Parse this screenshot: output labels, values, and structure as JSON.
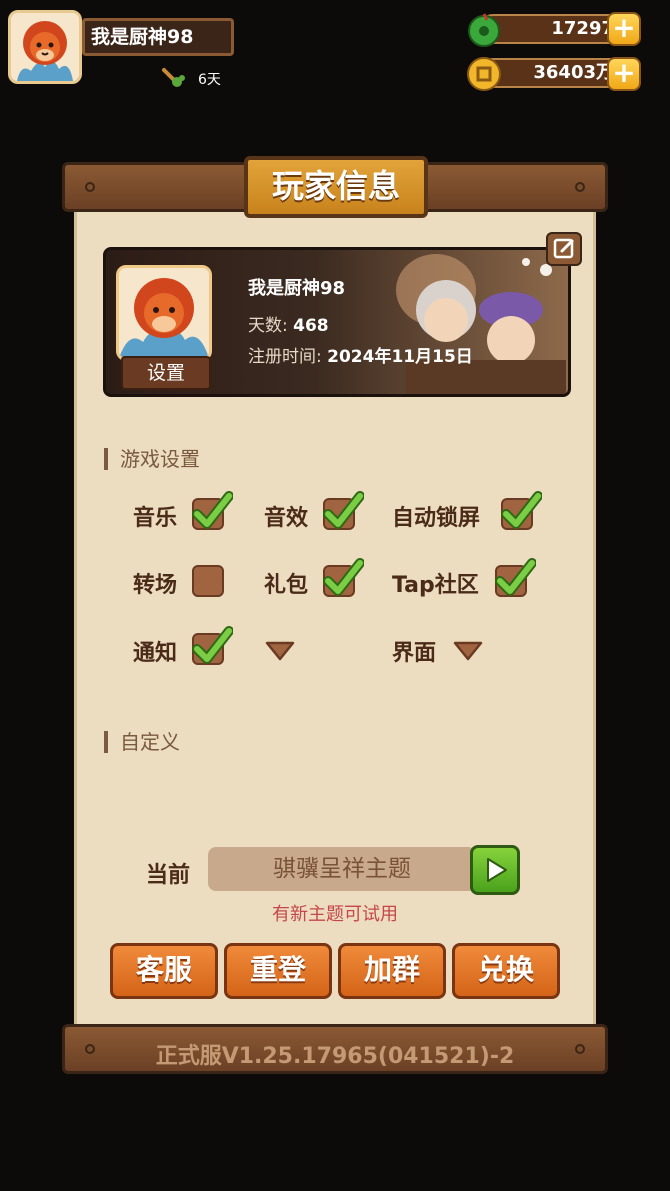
{
  "header": {
    "player_name": "我是厨神98",
    "days": "6天",
    "jade": "17297",
    "gold": "36403万"
  },
  "panel": {
    "title": "玩家信息",
    "profile": {
      "name": "我是厨神98",
      "days_label": "天数:",
      "days_value": "468",
      "reg_label": "注册时间:",
      "reg_value": "2024年11月15日",
      "settings_button": "设置"
    },
    "game_settings": {
      "title": "游戏设置",
      "options": [
        {
          "label": "音乐",
          "checked": true
        },
        {
          "label": "音效",
          "checked": true
        },
        {
          "label": "自动锁屏",
          "checked": true
        },
        {
          "label": "转场",
          "checked": false
        },
        {
          "label": "礼包",
          "checked": true
        },
        {
          "label": "Tap社区",
          "checked": true
        },
        {
          "label": "通知",
          "checked": true
        },
        {
          "label": "",
          "dropdown": true
        },
        {
          "label": "界面",
          "dropdown": true
        }
      ]
    },
    "custom": {
      "title": "自定义",
      "current_label": "当前",
      "theme_name": "骐骥呈祥主题",
      "hint": "有新主题可试用"
    },
    "buttons": [
      "客服",
      "重登",
      "加群",
      "兑换"
    ],
    "version": "正式服V1.25.17965(041521)-2"
  },
  "colors": {
    "paper": "#ecdcc0",
    "wood": "#7a4d2c",
    "orange_button": "#e87a2c",
    "check_green": "#6cbf3a",
    "hint_red": "#c5474b"
  }
}
